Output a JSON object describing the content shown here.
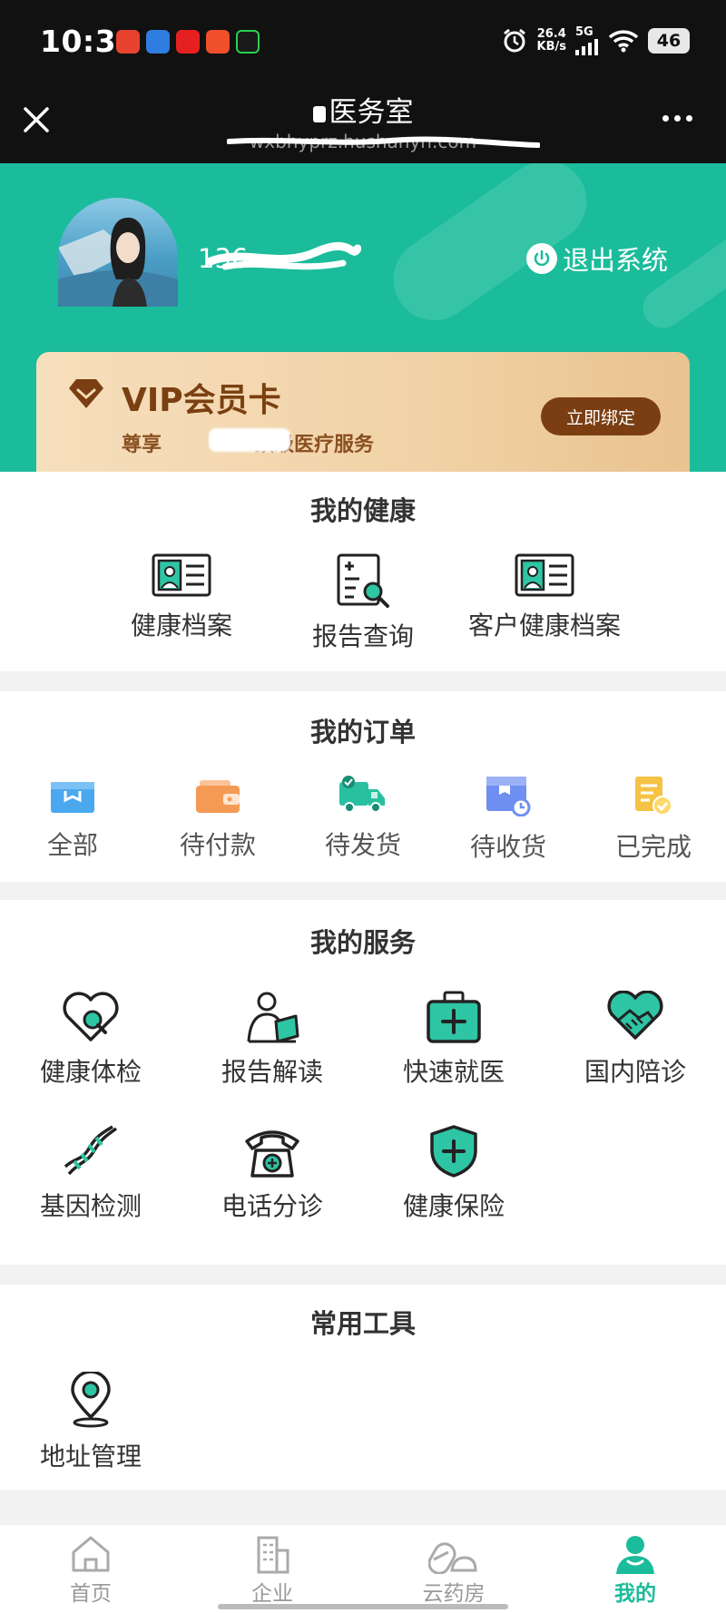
{
  "status_bar": {
    "time": "10:31",
    "net_speed_value": "26.4",
    "net_speed_unit": "KB/s",
    "signal_label": "5G",
    "battery": "46"
  },
  "title_bar": {
    "title": "医务室",
    "url": "wxbhyprz.hushanyn.com"
  },
  "profile": {
    "phone": "136",
    "logout_label": "退出系统"
  },
  "vip": {
    "title": "VIP会员卡",
    "subtitle_prefix": "尊享",
    "subtitle_suffix": "顶级医疗服务",
    "button_label": "立即绑定"
  },
  "health": {
    "title": "我的健康",
    "items": [
      {
        "label": "健康档案",
        "icon": "id-card-icon"
      },
      {
        "label": "报告查询",
        "icon": "report-search-icon"
      },
      {
        "label": "客户健康档案",
        "icon": "id-card-icon"
      }
    ]
  },
  "orders": {
    "title": "我的订单",
    "items": [
      {
        "label": "全部",
        "icon": "box-icon",
        "color": "#4aa8ef"
      },
      {
        "label": "待付款",
        "icon": "wallet-icon",
        "color": "#f59a54"
      },
      {
        "label": "待发货",
        "icon": "truck-icon",
        "color": "#29c0a0"
      },
      {
        "label": "待收货",
        "icon": "package-clock-icon",
        "color": "#6f8ff2"
      },
      {
        "label": "已完成",
        "icon": "doc-check-icon",
        "color": "#f5c344"
      }
    ]
  },
  "services": {
    "title": "我的服务",
    "items": [
      {
        "label": "健康体检",
        "icon": "heart-search-icon"
      },
      {
        "label": "报告解读",
        "icon": "doctor-report-icon"
      },
      {
        "label": "快速就医",
        "icon": "medical-kit-icon"
      },
      {
        "label": "国内陪诊",
        "icon": "heart-handshake-icon"
      },
      {
        "label": "基因检测",
        "icon": "dna-icon"
      },
      {
        "label": "电话分诊",
        "icon": "telephone-icon"
      },
      {
        "label": "健康保险",
        "icon": "shield-plus-icon"
      }
    ]
  },
  "tools": {
    "title": "常用工具",
    "items": [
      {
        "label": "地址管理",
        "icon": "location-pin-icon"
      }
    ]
  },
  "bottom_nav": {
    "items": [
      {
        "label": "首页",
        "icon": "home-icon"
      },
      {
        "label": "企业",
        "icon": "building-icon"
      },
      {
        "label": "云药房",
        "icon": "pill-icon"
      },
      {
        "label": "我的",
        "icon": "user-icon",
        "active": true
      }
    ]
  },
  "colors": {
    "accent": "#1bbc9b",
    "vip_brown": "#7a3e12",
    "icon_stroke": "#222222"
  }
}
